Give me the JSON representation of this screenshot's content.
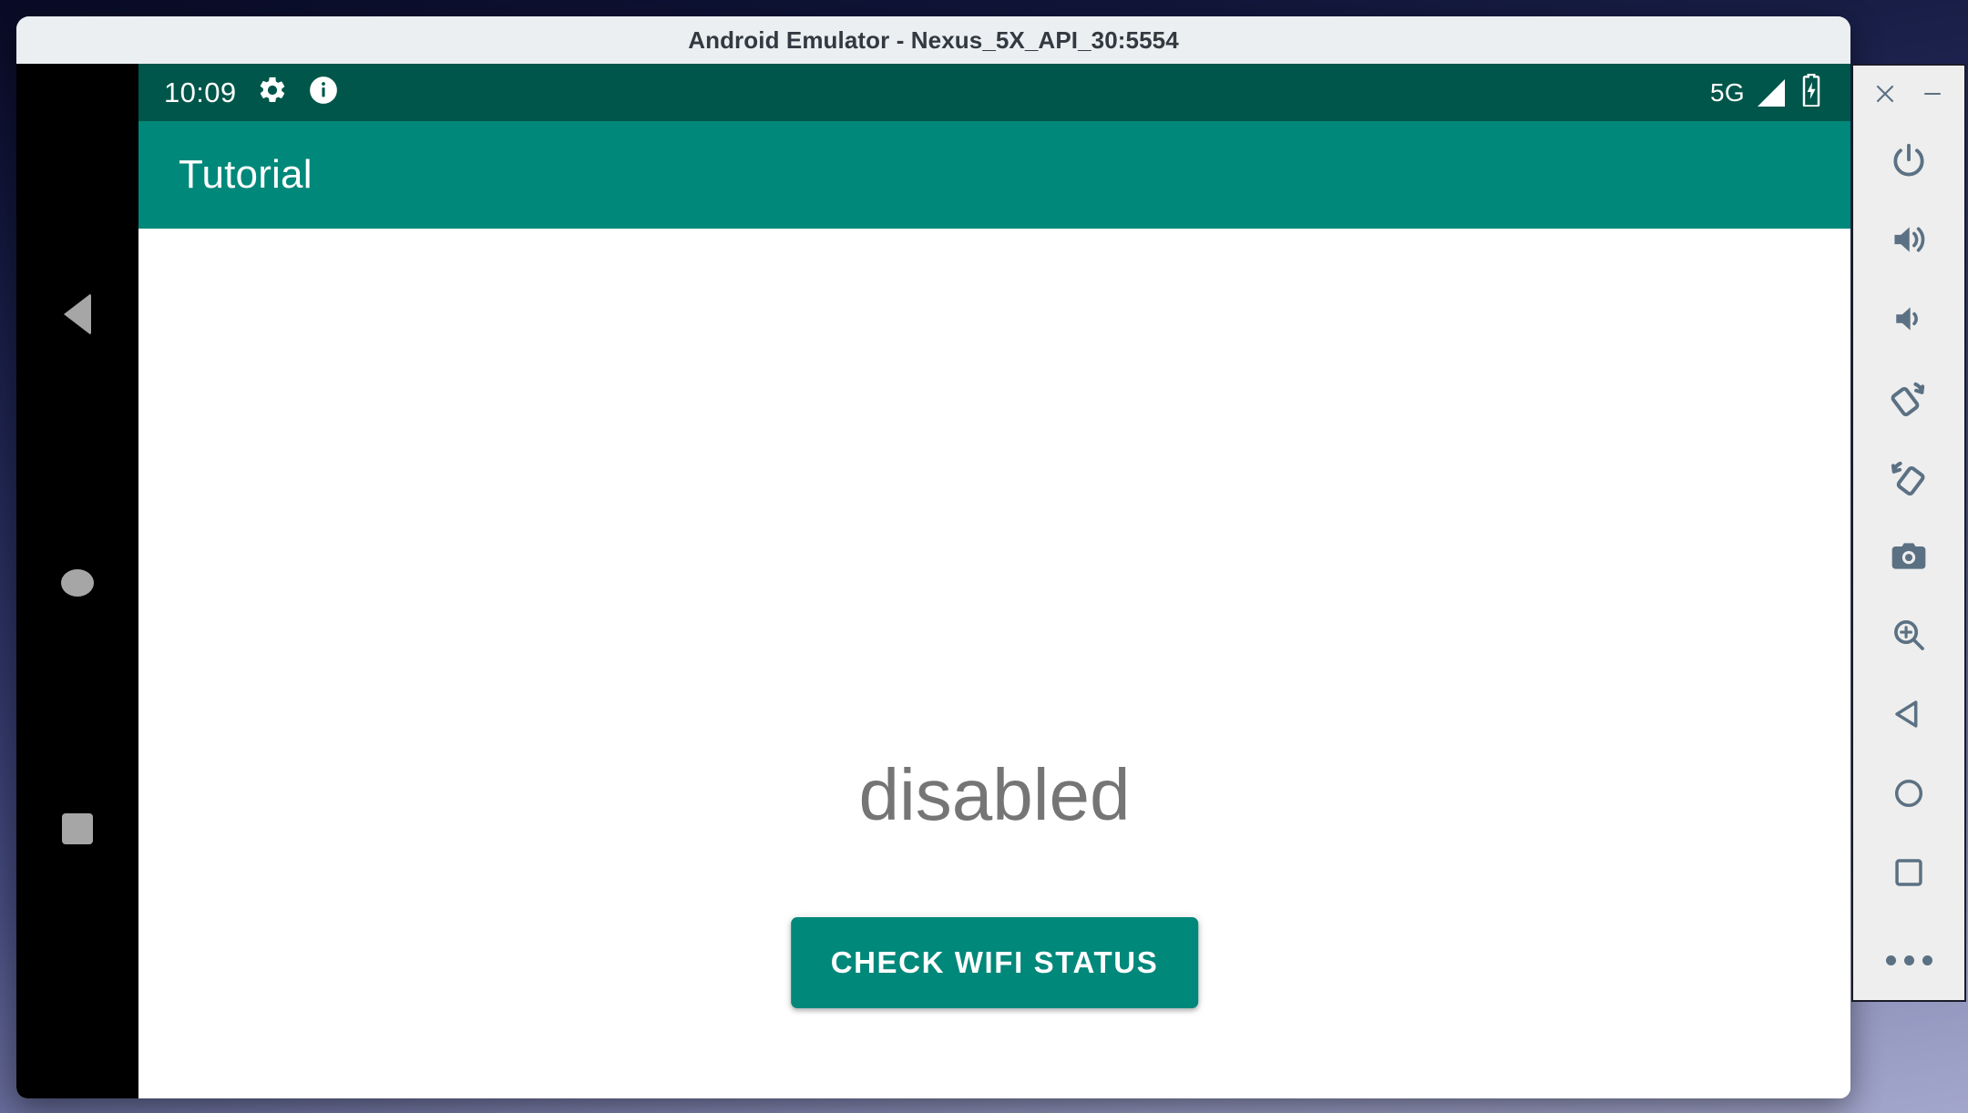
{
  "window": {
    "title": "Android Emulator - Nexus_5X_API_30:5554"
  },
  "device": {
    "status_bar": {
      "clock": "10:09",
      "icons": [
        "gear-icon",
        "info-icon"
      ],
      "network_label": "5G",
      "right_icons": [
        "signal-icon",
        "battery-charging-icon"
      ],
      "background_color": "#00564a"
    },
    "app_bar": {
      "title": "Tutorial",
      "background_color": "#00887a"
    },
    "content": {
      "wifi_status": "disabled",
      "wifi_status_color": "#757575",
      "check_button_label": "CHECK WIFI STATUS",
      "check_button_color": "#00887a",
      "background_color": "#ffffff"
    },
    "navigation_bar": {
      "background_color": "#000000",
      "buttons": [
        {
          "name": "back",
          "icon": "triangle-left-icon"
        },
        {
          "name": "home",
          "icon": "circle-icon"
        },
        {
          "name": "recents",
          "icon": "square-icon"
        }
      ]
    }
  },
  "emulator_toolbar": {
    "close_label": "✕",
    "minimize_label": "—",
    "buttons": [
      {
        "name": "power",
        "icon": "power-icon"
      },
      {
        "name": "volume-up",
        "icon": "volume-up-icon"
      },
      {
        "name": "volume-down",
        "icon": "volume-down-icon"
      },
      {
        "name": "rotate-left",
        "icon": "rotate-left-icon"
      },
      {
        "name": "rotate-right",
        "icon": "rotate-right-icon"
      },
      {
        "name": "screenshot",
        "icon": "camera-icon"
      },
      {
        "name": "zoom",
        "icon": "zoom-in-icon"
      },
      {
        "name": "back",
        "icon": "triangle-left-icon"
      },
      {
        "name": "home",
        "icon": "circle-icon"
      },
      {
        "name": "overview",
        "icon": "square-icon"
      },
      {
        "name": "more",
        "icon": "more-dots-icon"
      }
    ],
    "icon_color": "#5b7183",
    "background_color": "#eeeeee"
  }
}
